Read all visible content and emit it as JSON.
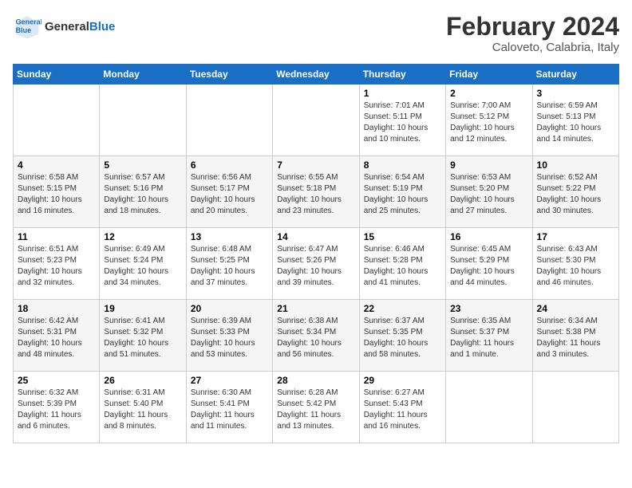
{
  "header": {
    "logo_line1": "General",
    "logo_line2": "Blue",
    "month": "February 2024",
    "location": "Caloveto, Calabria, Italy"
  },
  "weekdays": [
    "Sunday",
    "Monday",
    "Tuesday",
    "Wednesday",
    "Thursday",
    "Friday",
    "Saturday"
  ],
  "weeks": [
    [
      {
        "day": "",
        "info": ""
      },
      {
        "day": "",
        "info": ""
      },
      {
        "day": "",
        "info": ""
      },
      {
        "day": "",
        "info": ""
      },
      {
        "day": "1",
        "info": "Sunrise: 7:01 AM\nSunset: 5:11 PM\nDaylight: 10 hours\nand 10 minutes."
      },
      {
        "day": "2",
        "info": "Sunrise: 7:00 AM\nSunset: 5:12 PM\nDaylight: 10 hours\nand 12 minutes."
      },
      {
        "day": "3",
        "info": "Sunrise: 6:59 AM\nSunset: 5:13 PM\nDaylight: 10 hours\nand 14 minutes."
      }
    ],
    [
      {
        "day": "4",
        "info": "Sunrise: 6:58 AM\nSunset: 5:15 PM\nDaylight: 10 hours\nand 16 minutes."
      },
      {
        "day": "5",
        "info": "Sunrise: 6:57 AM\nSunset: 5:16 PM\nDaylight: 10 hours\nand 18 minutes."
      },
      {
        "day": "6",
        "info": "Sunrise: 6:56 AM\nSunset: 5:17 PM\nDaylight: 10 hours\nand 20 minutes."
      },
      {
        "day": "7",
        "info": "Sunrise: 6:55 AM\nSunset: 5:18 PM\nDaylight: 10 hours\nand 23 minutes."
      },
      {
        "day": "8",
        "info": "Sunrise: 6:54 AM\nSunset: 5:19 PM\nDaylight: 10 hours\nand 25 minutes."
      },
      {
        "day": "9",
        "info": "Sunrise: 6:53 AM\nSunset: 5:20 PM\nDaylight: 10 hours\nand 27 minutes."
      },
      {
        "day": "10",
        "info": "Sunrise: 6:52 AM\nSunset: 5:22 PM\nDaylight: 10 hours\nand 30 minutes."
      }
    ],
    [
      {
        "day": "11",
        "info": "Sunrise: 6:51 AM\nSunset: 5:23 PM\nDaylight: 10 hours\nand 32 minutes."
      },
      {
        "day": "12",
        "info": "Sunrise: 6:49 AM\nSunset: 5:24 PM\nDaylight: 10 hours\nand 34 minutes."
      },
      {
        "day": "13",
        "info": "Sunrise: 6:48 AM\nSunset: 5:25 PM\nDaylight: 10 hours\nand 37 minutes."
      },
      {
        "day": "14",
        "info": "Sunrise: 6:47 AM\nSunset: 5:26 PM\nDaylight: 10 hours\nand 39 minutes."
      },
      {
        "day": "15",
        "info": "Sunrise: 6:46 AM\nSunset: 5:28 PM\nDaylight: 10 hours\nand 41 minutes."
      },
      {
        "day": "16",
        "info": "Sunrise: 6:45 AM\nSunset: 5:29 PM\nDaylight: 10 hours\nand 44 minutes."
      },
      {
        "day": "17",
        "info": "Sunrise: 6:43 AM\nSunset: 5:30 PM\nDaylight: 10 hours\nand 46 minutes."
      }
    ],
    [
      {
        "day": "18",
        "info": "Sunrise: 6:42 AM\nSunset: 5:31 PM\nDaylight: 10 hours\nand 48 minutes."
      },
      {
        "day": "19",
        "info": "Sunrise: 6:41 AM\nSunset: 5:32 PM\nDaylight: 10 hours\nand 51 minutes."
      },
      {
        "day": "20",
        "info": "Sunrise: 6:39 AM\nSunset: 5:33 PM\nDaylight: 10 hours\nand 53 minutes."
      },
      {
        "day": "21",
        "info": "Sunrise: 6:38 AM\nSunset: 5:34 PM\nDaylight: 10 hours\nand 56 minutes."
      },
      {
        "day": "22",
        "info": "Sunrise: 6:37 AM\nSunset: 5:35 PM\nDaylight: 10 hours\nand 58 minutes."
      },
      {
        "day": "23",
        "info": "Sunrise: 6:35 AM\nSunset: 5:37 PM\nDaylight: 11 hours\nand 1 minute."
      },
      {
        "day": "24",
        "info": "Sunrise: 6:34 AM\nSunset: 5:38 PM\nDaylight: 11 hours\nand 3 minutes."
      }
    ],
    [
      {
        "day": "25",
        "info": "Sunrise: 6:32 AM\nSunset: 5:39 PM\nDaylight: 11 hours\nand 6 minutes."
      },
      {
        "day": "26",
        "info": "Sunrise: 6:31 AM\nSunset: 5:40 PM\nDaylight: 11 hours\nand 8 minutes."
      },
      {
        "day": "27",
        "info": "Sunrise: 6:30 AM\nSunset: 5:41 PM\nDaylight: 11 hours\nand 11 minutes."
      },
      {
        "day": "28",
        "info": "Sunrise: 6:28 AM\nSunset: 5:42 PM\nDaylight: 11 hours\nand 13 minutes."
      },
      {
        "day": "29",
        "info": "Sunrise: 6:27 AM\nSunset: 5:43 PM\nDaylight: 11 hours\nand 16 minutes."
      },
      {
        "day": "",
        "info": ""
      },
      {
        "day": "",
        "info": ""
      }
    ]
  ]
}
